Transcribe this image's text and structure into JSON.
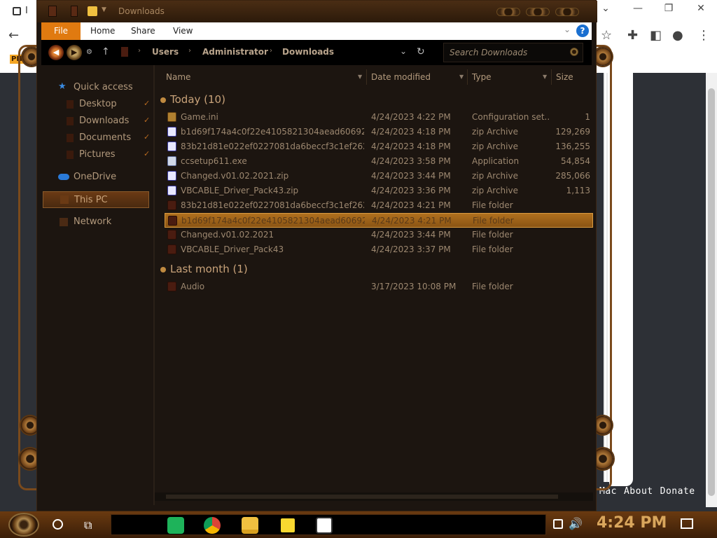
{
  "browser": {
    "tab_title": "I",
    "badge": "PH",
    "footer_links": [
      "Mac",
      "About",
      "Donate"
    ]
  },
  "window": {
    "title": "Downloads"
  },
  "ribbon": {
    "file": "File",
    "tabs": [
      "Home",
      "Share",
      "View"
    ],
    "help": "?"
  },
  "address": {
    "crumbs": [
      "Users",
      "Administrator",
      "Downloads"
    ],
    "search_placeholder": "Search Downloads"
  },
  "sidebar": {
    "items": [
      {
        "label": "Quick access",
        "pinned": false
      },
      {
        "label": "Desktop",
        "pinned": true
      },
      {
        "label": "Downloads",
        "pinned": true
      },
      {
        "label": "Documents",
        "pinned": true
      },
      {
        "label": "Pictures",
        "pinned": true
      },
      {
        "label": "OneDrive",
        "pinned": false
      },
      {
        "label": "This PC",
        "pinned": false
      },
      {
        "label": "Network",
        "pinned": false
      }
    ]
  },
  "columns": {
    "name": "Name",
    "date": "Date modified",
    "type": "Type",
    "size": "Size"
  },
  "groups": [
    {
      "title": "Today (10)",
      "rows": [
        {
          "name": "Game.ini",
          "date": "4/24/2023 4:22 PM",
          "type": "Configuration set...",
          "size": "1",
          "icon": "config-file-icon"
        },
        {
          "name": "b1d69f174a4c0f22e4105821304aead6069207...",
          "date": "4/24/2023 4:18 PM",
          "type": "zip Archive",
          "size": "129,269",
          "icon": "zip-archive-icon"
        },
        {
          "name": "83b21d81e022ef0227081da6beccf3c1ef262e2...",
          "date": "4/24/2023 4:18 PM",
          "type": "zip Archive",
          "size": "136,255",
          "icon": "zip-archive-icon"
        },
        {
          "name": "ccsetup611.exe",
          "date": "4/24/2023 3:58 PM",
          "type": "Application",
          "size": "54,854",
          "icon": "application-icon"
        },
        {
          "name": "Changed.v01.02.2021.zip",
          "date": "4/24/2023 3:44 PM",
          "type": "zip Archive",
          "size": "285,066",
          "icon": "zip-archive-icon"
        },
        {
          "name": "VBCABLE_Driver_Pack43.zip",
          "date": "4/24/2023 3:36 PM",
          "type": "zip Archive",
          "size": "1,113",
          "icon": "zip-archive-icon"
        },
        {
          "name": "83b21d81e022ef0227081da6beccf3c1ef262e2...",
          "date": "4/24/2023 4:21 PM",
          "type": "File folder",
          "size": "",
          "icon": "folder-icon"
        },
        {
          "name": "b1d69f174a4c0f22e4105821304aead6069207...",
          "date": "4/24/2023 4:21 PM",
          "type": "File folder",
          "size": "",
          "icon": "folder-icon",
          "selected": true
        },
        {
          "name": "Changed.v01.02.2021",
          "date": "4/24/2023 3:44 PM",
          "type": "File folder",
          "size": "",
          "icon": "folder-icon"
        },
        {
          "name": "VBCABLE_Driver_Pack43",
          "date": "4/24/2023 3:37 PM",
          "type": "File folder",
          "size": "",
          "icon": "folder-icon"
        }
      ]
    },
    {
      "title": "Last month (1)",
      "rows": [
        {
          "name": "Audio",
          "date": "3/17/2023 10:08 PM",
          "type": "File folder",
          "size": "",
          "icon": "folder-icon"
        }
      ]
    }
  ],
  "taskbar": {
    "clock": "4:24 PM",
    "apps": [
      "google-sheets-icon",
      "chrome-icon",
      "file-explorer-icon",
      "sticky-notes-icon",
      "app-icon"
    ]
  },
  "colors": {
    "accent": "#e07a10",
    "selection": "#b0701e",
    "text": "#9d8870",
    "clock": "#d9a65c"
  }
}
